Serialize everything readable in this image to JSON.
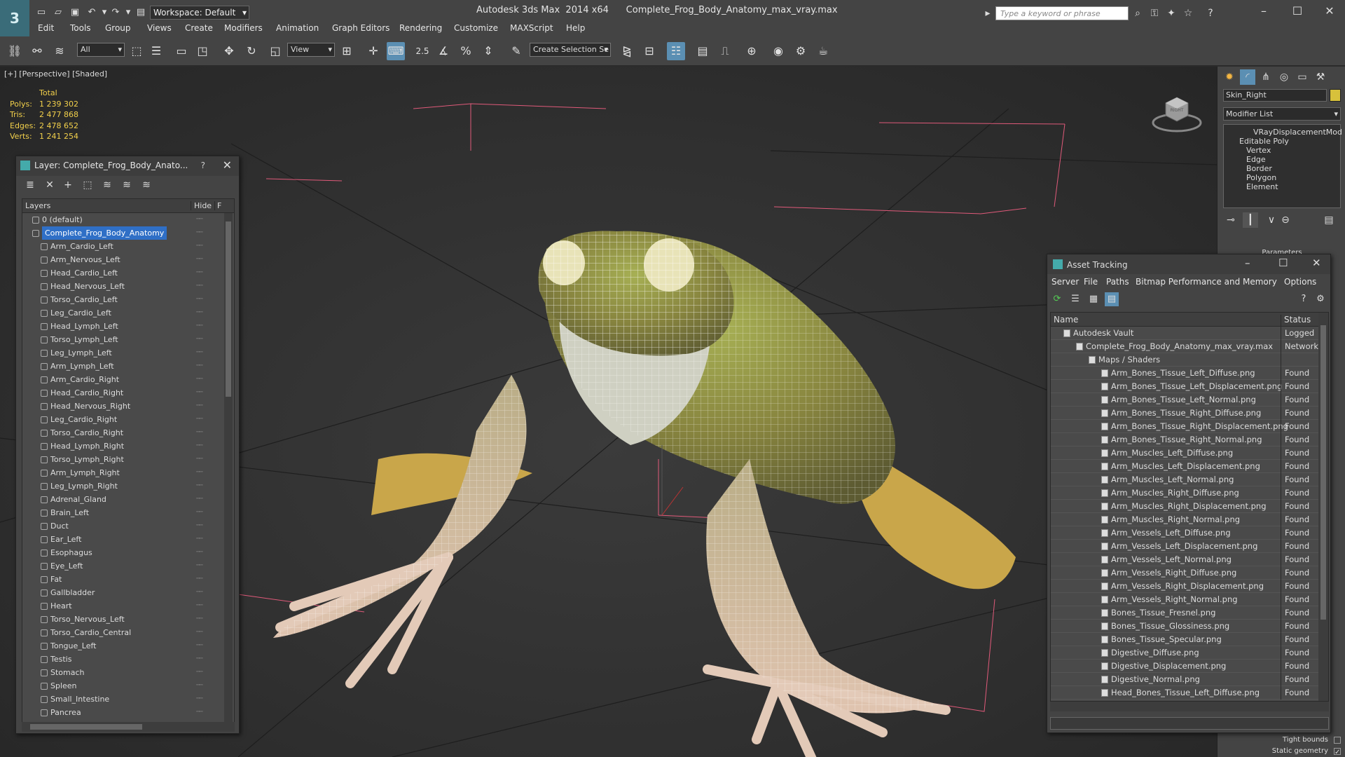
{
  "titlebar": {
    "app_logo": "3",
    "workspace": "Workspace: Default",
    "title": "Autodesk 3ds Max  2014 x64      Complete_Frog_Body_Anatomy_max_vray.max",
    "search_placeholder": "Type a keyword or phrase"
  },
  "menu": [
    "Edit",
    "Tools",
    "Group",
    "Views",
    "Create",
    "Modifiers",
    "Animation",
    "Graph Editors",
    "Rendering",
    "Customize",
    "MAXScript",
    "Help"
  ],
  "toolbar": {
    "filter": "All",
    "ref_coord": "View",
    "selection_set": "Create Selection Se",
    "snap_value": "2.5"
  },
  "viewport": {
    "label": "[+] [Perspective] [Shaded]",
    "stats_header": "Total",
    "stats": [
      {
        "k": "Polys:",
        "v": "1 239 302"
      },
      {
        "k": "Tris:",
        "v": "2 477 868"
      },
      {
        "k": "Edges:",
        "v": "2 478 652"
      },
      {
        "k": "Verts:",
        "v": "1 241 254"
      }
    ],
    "viewcube_label": "RIGHT"
  },
  "layer_panel": {
    "title": "Layer: Complete_Frog_Body_Anato...",
    "help": "?",
    "col_layers": "Layers",
    "col_hide": "Hide",
    "col_f": "F",
    "rows": [
      {
        "name": "0 (default)",
        "level": 1
      },
      {
        "name": "Complete_Frog_Body_Anatomy",
        "level": 1,
        "selected": true
      },
      {
        "name": "Arm_Cardio_Left",
        "level": 2
      },
      {
        "name": "Arm_Nervous_Left",
        "level": 2
      },
      {
        "name": "Head_Cardio_Left",
        "level": 2
      },
      {
        "name": "Head_Nervous_Left",
        "level": 2
      },
      {
        "name": "Torso_Cardio_Left",
        "level": 2
      },
      {
        "name": "Leg_Cardio_Left",
        "level": 2
      },
      {
        "name": "Head_Lymph_Left",
        "level": 2
      },
      {
        "name": "Torso_Lymph_Left",
        "level": 2
      },
      {
        "name": "Leg_Lymph_Left",
        "level": 2
      },
      {
        "name": "Arm_Lymph_Left",
        "level": 2
      },
      {
        "name": "Arm_Cardio_Right",
        "level": 2
      },
      {
        "name": "Head_Cardio_Right",
        "level": 2
      },
      {
        "name": "Head_Nervous_Right",
        "level": 2
      },
      {
        "name": "Leg_Cardio_Right",
        "level": 2
      },
      {
        "name": "Torso_Cardio_Right",
        "level": 2
      },
      {
        "name": "Head_Lymph_Right",
        "level": 2
      },
      {
        "name": "Torso_Lymph_Right",
        "level": 2
      },
      {
        "name": "Arm_Lymph_Right",
        "level": 2
      },
      {
        "name": "Leg_Lymph_Right",
        "level": 2
      },
      {
        "name": "Adrenal_Gland",
        "level": 2
      },
      {
        "name": "Brain_Left",
        "level": 2
      },
      {
        "name": "Duct",
        "level": 2
      },
      {
        "name": "Ear_Left",
        "level": 2
      },
      {
        "name": "Esophagus",
        "level": 2
      },
      {
        "name": "Eye_Left",
        "level": 2
      },
      {
        "name": "Fat",
        "level": 2
      },
      {
        "name": "Gallbladder",
        "level": 2
      },
      {
        "name": "Heart",
        "level": 2
      },
      {
        "name": "Torso_Nervous_Left",
        "level": 2
      },
      {
        "name": "Torso_Cardio_Central",
        "level": 2
      },
      {
        "name": "Tongue_Left",
        "level": 2
      },
      {
        "name": "Testis",
        "level": 2
      },
      {
        "name": "Stomach",
        "level": 2
      },
      {
        "name": "Spleen",
        "level": 2
      },
      {
        "name": "Small_Intestine",
        "level": 2
      },
      {
        "name": "Pancrea",
        "level": 2
      }
    ]
  },
  "command_panel": {
    "object_name": "Skin_Right",
    "modifier_list": "Modifier List",
    "stack": [
      {
        "name": "VRayDisplacementMod",
        "level": 1
      },
      {
        "name": "Editable Poly",
        "level": 1
      },
      {
        "name": "Vertex",
        "level": 2
      },
      {
        "name": "Edge",
        "level": 2
      },
      {
        "name": "Border",
        "level": 2
      },
      {
        "name": "Polygon",
        "level": 2
      },
      {
        "name": "Element",
        "level": 2
      }
    ],
    "parameters": "Parameters",
    "tight_bounds": "Tight bounds",
    "static_geometry": "Static geometry",
    "object_color": "#d7c13b"
  },
  "asset_tracking": {
    "title": "Asset Tracking",
    "menu": [
      "Server",
      "File",
      "Paths",
      "Bitmap Performance and Memory",
      "Options"
    ],
    "col_name": "Name",
    "col_status": "Status",
    "rows": [
      {
        "name": "Autodesk Vault",
        "level": 1,
        "status": "Logged"
      },
      {
        "name": "Complete_Frog_Body_Anatomy_max_vray.max",
        "level": 2,
        "status": "Network"
      },
      {
        "name": "Maps / Shaders",
        "level": 3,
        "status": ""
      },
      {
        "name": "Arm_Bones_Tissue_Left_Diffuse.png",
        "level": 4,
        "status": "Found"
      },
      {
        "name": "Arm_Bones_Tissue_Left_Displacement.png",
        "level": 4,
        "status": "Found"
      },
      {
        "name": "Arm_Bones_Tissue_Left_Normal.png",
        "level": 4,
        "status": "Found"
      },
      {
        "name": "Arm_Bones_Tissue_Right_Diffuse.png",
        "level": 4,
        "status": "Found"
      },
      {
        "name": "Arm_Bones_Tissue_Right_Displacement.png",
        "level": 4,
        "status": "Found"
      },
      {
        "name": "Arm_Bones_Tissue_Right_Normal.png",
        "level": 4,
        "status": "Found"
      },
      {
        "name": "Arm_Muscles_Left_Diffuse.png",
        "level": 4,
        "status": "Found"
      },
      {
        "name": "Arm_Muscles_Left_Displacement.png",
        "level": 4,
        "status": "Found"
      },
      {
        "name": "Arm_Muscles_Left_Normal.png",
        "level": 4,
        "status": "Found"
      },
      {
        "name": "Arm_Muscles_Right_Diffuse.png",
        "level": 4,
        "status": "Found"
      },
      {
        "name": "Arm_Muscles_Right_Displacement.png",
        "level": 4,
        "status": "Found"
      },
      {
        "name": "Arm_Muscles_Right_Normal.png",
        "level": 4,
        "status": "Found"
      },
      {
        "name": "Arm_Vessels_Left_Diffuse.png",
        "level": 4,
        "status": "Found"
      },
      {
        "name": "Arm_Vessels_Left_Displacement.png",
        "level": 4,
        "status": "Found"
      },
      {
        "name": "Arm_Vessels_Left_Normal.png",
        "level": 4,
        "status": "Found"
      },
      {
        "name": "Arm_Vessels_Right_Diffuse.png",
        "level": 4,
        "status": "Found"
      },
      {
        "name": "Arm_Vessels_Right_Displacement.png",
        "level": 4,
        "status": "Found"
      },
      {
        "name": "Arm_Vessels_Right_Normal.png",
        "level": 4,
        "status": "Found"
      },
      {
        "name": "Bones_Tissue_Fresnel.png",
        "level": 4,
        "status": "Found"
      },
      {
        "name": "Bones_Tissue_Glossiness.png",
        "level": 4,
        "status": "Found"
      },
      {
        "name": "Bones_Tissue_Specular.png",
        "level": 4,
        "status": "Found"
      },
      {
        "name": "Digestive_Diffuse.png",
        "level": 4,
        "status": "Found"
      },
      {
        "name": "Digestive_Displacement.png",
        "level": 4,
        "status": "Found"
      },
      {
        "name": "Digestive_Normal.png",
        "level": 4,
        "status": "Found"
      },
      {
        "name": "Head_Bones_Tissue_Left_Diffuse.png",
        "level": 4,
        "status": "Found"
      }
    ]
  }
}
